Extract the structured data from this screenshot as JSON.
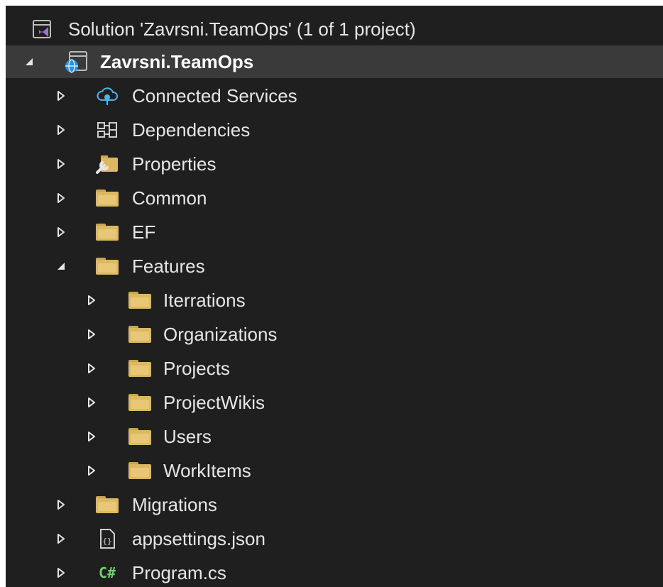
{
  "colors": {
    "background": "#1f1f1f",
    "selected_row": "#3a3a3a",
    "text": "#e6e6e6",
    "folder": "#dcb862",
    "csharp": "#6fcf6f",
    "cloud": "#4fb3e8"
  },
  "tree": {
    "solution": {
      "label": "Solution 'Zavrsni.TeamOps' (1 of 1 project)",
      "icon": "solution-icon"
    },
    "project": {
      "label": "Zavrsni.TeamOps",
      "icon": "web-project-icon"
    },
    "items": {
      "connected_services": {
        "label": "Connected Services",
        "icon": "connected-services-icon"
      },
      "dependencies": {
        "label": "Dependencies",
        "icon": "dependencies-icon"
      },
      "properties": {
        "label": "Properties",
        "icon": "properties-icon"
      },
      "common": {
        "label": "Common",
        "icon": "folder-icon"
      },
      "ef": {
        "label": "EF",
        "icon": "folder-icon"
      },
      "features": {
        "label": "Features",
        "icon": "folder-icon",
        "children": {
          "iterrations": {
            "label": "Iterrations",
            "icon": "folder-icon"
          },
          "organizations": {
            "label": "Organizations",
            "icon": "folder-icon"
          },
          "projects": {
            "label": "Projects",
            "icon": "folder-icon"
          },
          "projectwikis": {
            "label": "ProjectWikis",
            "icon": "folder-icon"
          },
          "users": {
            "label": "Users",
            "icon": "folder-icon"
          },
          "workitems": {
            "label": "WorkItems",
            "icon": "folder-icon"
          }
        }
      },
      "migrations": {
        "label": "Migrations",
        "icon": "folder-icon"
      },
      "appsettings": {
        "label": "appsettings.json",
        "icon": "json-file-icon"
      },
      "program": {
        "label": "Program.cs",
        "icon": "csharp-file-icon",
        "icon_text": "C#"
      }
    }
  }
}
